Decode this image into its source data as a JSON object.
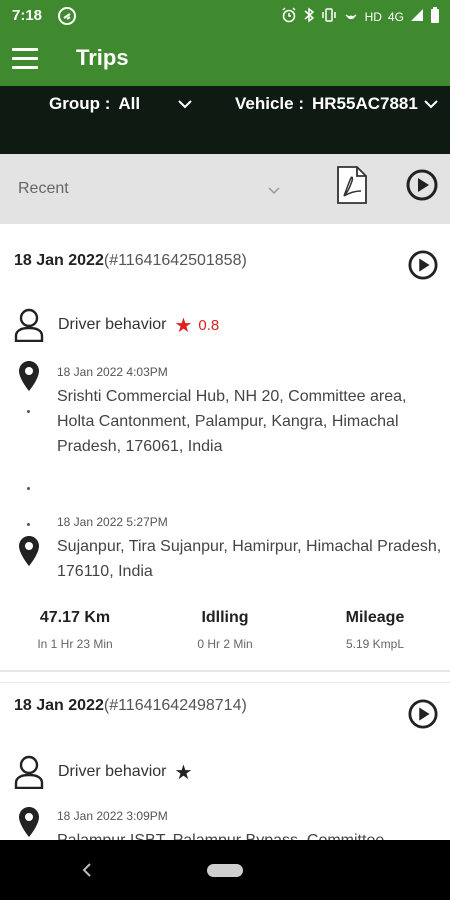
{
  "status_bar": {
    "time": "7:18",
    "network": "HD",
    "signal": "4G"
  },
  "app_bar": {
    "title": "Trips",
    "menu_icon": "menu-icon"
  },
  "filters": {
    "group_label": "Group :",
    "group_value": "All",
    "vehicle_label": "Vehicle :",
    "vehicle_value": "HR55AC7881"
  },
  "recent_bar": {
    "selected": "Recent",
    "icons": [
      "chevron-down-icon",
      "pdf-icon",
      "play-icon"
    ]
  },
  "trips": [
    {
      "date": "18 Jan 2022",
      "trip_id": "(#11641642501858)",
      "driver_label": "Driver behavior",
      "score": "0.8",
      "star_color": "#e02020",
      "start": {
        "time": "18 Jan 2022 4:03PM",
        "address": "Srishti Commercial Hub, NH 20, Committee area, Holta Cantonment, Palampur, Kangra, Himachal Pradesh, 176061, India"
      },
      "end": {
        "time": "18 Jan 2022 5:27PM",
        "address": "Sujanpur, Tira Sujanpur, Hamirpur, Himachal Pradesh, 176110, India"
      },
      "stats": [
        {
          "value": "47.17 Km",
          "sub": "In 1 Hr 23 Min"
        },
        {
          "value": "Idlling",
          "sub": "0 Hr 2 Min"
        },
        {
          "value": "Mileage",
          "sub": "5.19 KmpL"
        }
      ]
    },
    {
      "date": "18 Jan 2022",
      "trip_id": "(#11641642498714)",
      "driver_label": "Driver behavior",
      "score": "",
      "star_color": "#222222",
      "start": {
        "time": "18 Jan 2022 3:09PM",
        "address": "Palampur ISBT, Palampur Bypass, Committee"
      }
    }
  ],
  "colors": {
    "primary": "#3f8a2f",
    "filter_bg": "#0f1a12",
    "recent_bg": "#e3e3e3",
    "score_red": "#e02020"
  }
}
